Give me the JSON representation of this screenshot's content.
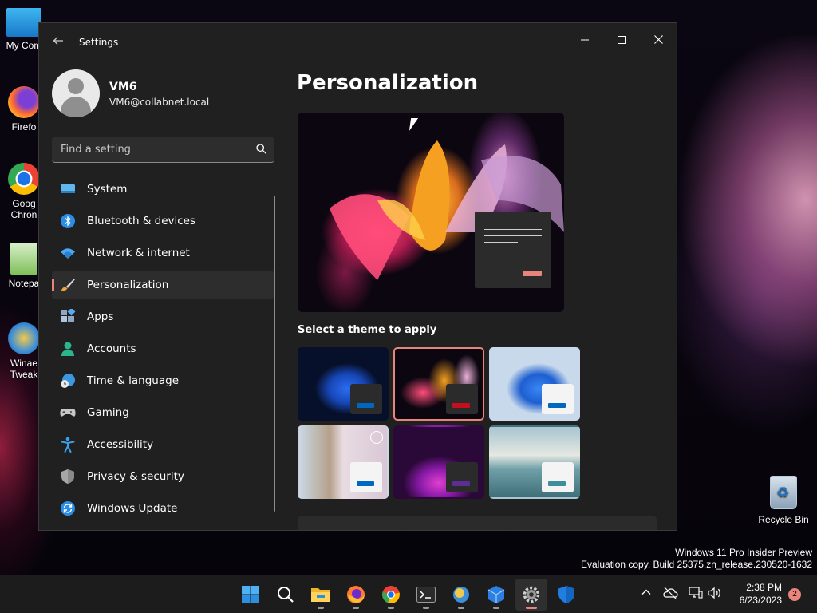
{
  "desktop": {
    "icons": [
      {
        "label": "My Com"
      },
      {
        "label": "Firefo"
      },
      {
        "label": "Goog Chron"
      },
      {
        "label": "Notepa"
      },
      {
        "label": "Winae Tweak"
      }
    ],
    "recycle_bin": "Recycle Bin",
    "watermark_line1": "Windows 11 Pro Insider Preview",
    "watermark_line2": "Evaluation copy. Build 25375.zn_release.230520-1632"
  },
  "window": {
    "title": "Settings",
    "controls": {
      "minimize": "—",
      "maximize": "☐",
      "close": "✕"
    }
  },
  "profile": {
    "name": "VM6",
    "email": "VM6@collabnet.local"
  },
  "search": {
    "placeholder": "Find a setting"
  },
  "nav": {
    "items": [
      {
        "label": "System",
        "icon": "system-icon"
      },
      {
        "label": "Bluetooth & devices",
        "icon": "bluetooth-icon"
      },
      {
        "label": "Network & internet",
        "icon": "wifi-icon"
      },
      {
        "label": "Personalization",
        "icon": "brush-icon",
        "active": true
      },
      {
        "label": "Apps",
        "icon": "apps-icon"
      },
      {
        "label": "Accounts",
        "icon": "accounts-icon"
      },
      {
        "label": "Time & language",
        "icon": "globe-clock-icon"
      },
      {
        "label": "Gaming",
        "icon": "gamepad-icon"
      },
      {
        "label": "Accessibility",
        "icon": "accessibility-icon"
      },
      {
        "label": "Privacy & security",
        "icon": "shield-icon"
      },
      {
        "label": "Windows Update",
        "icon": "update-icon"
      }
    ]
  },
  "content": {
    "title": "Personalization",
    "themes_label": "Select a theme to apply",
    "themes": [
      {
        "name": "windows-light-bloom",
        "accent": "#0067c0"
      },
      {
        "name": "glow",
        "accent": "#c50f1f",
        "selected": true
      },
      {
        "name": "windows-dark-bloom",
        "accent": "#0067c0"
      },
      {
        "name": "flowers",
        "accent": "#0067c0"
      },
      {
        "name": "captured-motion",
        "accent": "#5c2e91"
      },
      {
        "name": "sunrise-lake",
        "accent": "#3e8f9c"
      }
    ]
  },
  "taskbar": {
    "clock_time": "2:38 PM",
    "clock_date": "6/23/2023",
    "notification_count": "2"
  },
  "colors": {
    "accent": "#e8847c",
    "window_bg": "#202020",
    "active_nav_bg": "#2d2d2d"
  }
}
